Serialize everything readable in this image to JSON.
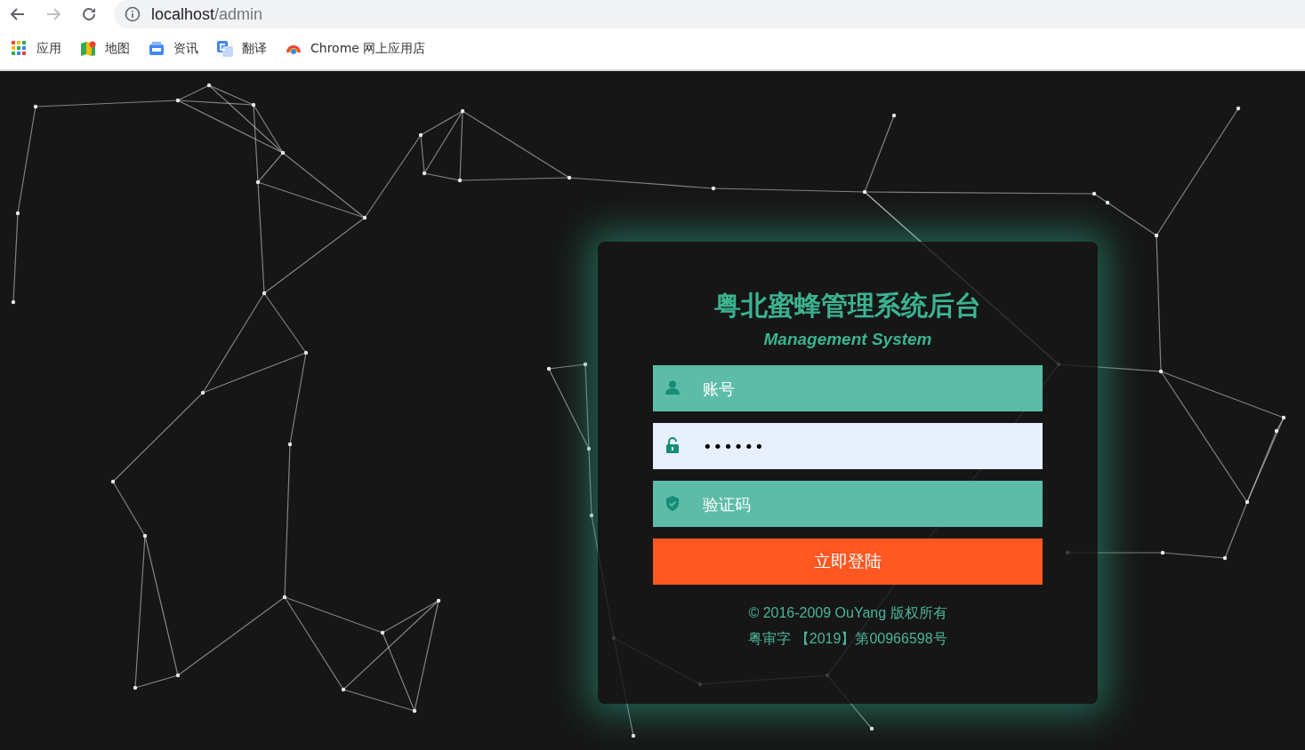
{
  "browser": {
    "url_host": "localhost",
    "url_path": "/admin",
    "bookmarks": [
      {
        "kind": "apps",
        "label": "应用"
      },
      {
        "kind": "maps",
        "label": "地图"
      },
      {
        "kind": "news",
        "label": "资讯"
      },
      {
        "kind": "translate",
        "label": "翻译"
      },
      {
        "kind": "store",
        "label": "Chrome 网上应用店"
      }
    ]
  },
  "login": {
    "title": "粤北蜜蜂管理系统后台",
    "subtitle": "Management System",
    "fields": [
      {
        "kind": "user",
        "placeholder": "账号",
        "autofilled": false
      },
      {
        "kind": "lock",
        "value": "••••••",
        "autofilled": true
      },
      {
        "kind": "shield",
        "placeholder": "验证码",
        "autofilled": false
      }
    ],
    "button": "立即登陆",
    "footer": [
      "© 2016-2009 OuYang 版权所有",
      "粤审字 【2019】第00966598号"
    ]
  }
}
